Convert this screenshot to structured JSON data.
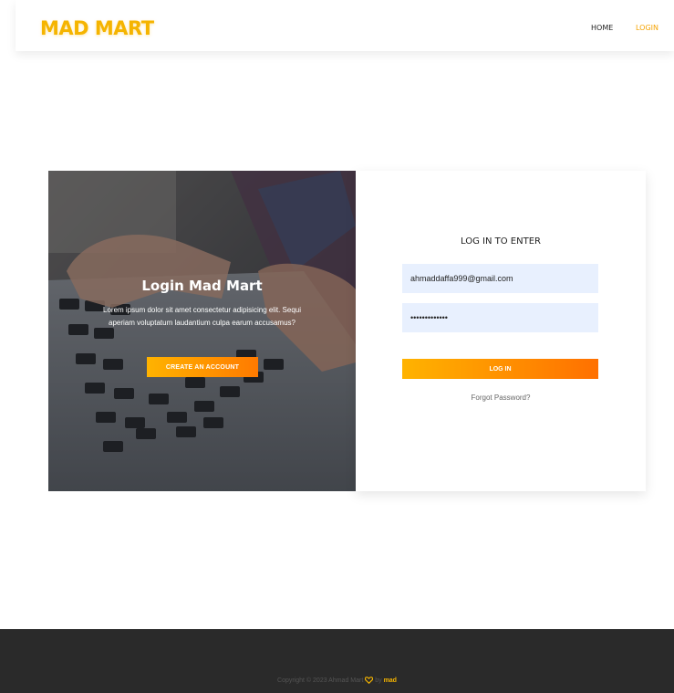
{
  "navbar": {
    "brand": "MAD MART",
    "links": [
      {
        "label": "HOME"
      },
      {
        "label": "LOGIN"
      }
    ]
  },
  "hero": {
    "title": "Login Mad Mart",
    "description": "Lorem ipsum dolor sit amet consectetur adipisicing elit. Sequi aperiam voluptatum laudantium culpa earum accusamus?",
    "cta_label": "CREATE AN ACCOUNT"
  },
  "login_form": {
    "title": "LOG IN TO ENTER",
    "email_value": "ahmaddaffa999@gmail.com",
    "password_value": "•••••••••••••",
    "submit_label": "LOG IN",
    "forgot_label": "Forgot Password?"
  },
  "footer": {
    "copyright": "Copyright © 2023 Ahmad Mart",
    "by": "by",
    "author": "mad"
  },
  "colors": {
    "brand": "#f5b400",
    "accent_gradient_start": "#ffb300",
    "accent_gradient_end": "#ff7000",
    "input_background": "#e8f0fe",
    "footer_background": "#2a2a2a"
  }
}
